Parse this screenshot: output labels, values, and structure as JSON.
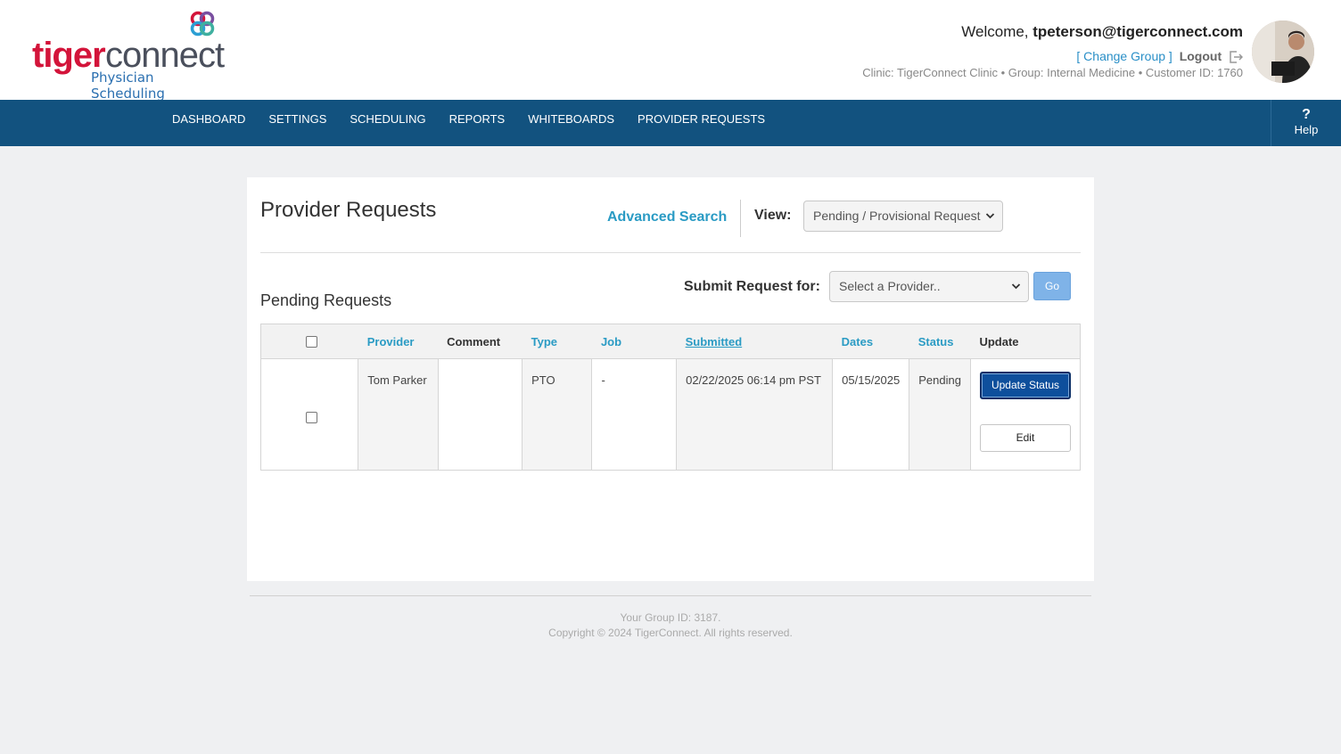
{
  "brand": {
    "logo_word_1": "tiger",
    "logo_word_2": "connect",
    "subtitle": "Physician Scheduling",
    "red": "#d3143a",
    "nav_blue": "#12527f"
  },
  "user": {
    "welcome_prefix": "Welcome, ",
    "email": "tpeterson@tigerconnect.com",
    "change_group": "[ Change Group ]",
    "logout": "Logout",
    "clinic_line": "Clinic: TigerConnect Clinic • Group: Internal Medicine • Customer ID: 1760"
  },
  "nav": {
    "items": [
      "DASHBOARD",
      "SETTINGS",
      "SCHEDULING",
      "REPORTS",
      "WHITEBOARDS",
      "PROVIDER REQUESTS"
    ],
    "help_icon": "?",
    "help_label": "Help"
  },
  "page": {
    "title": "Provider Requests",
    "advanced_search": "Advanced Search",
    "view_label": "View:",
    "view_value": "Pending / Provisional Request",
    "pending_title": "Pending Requests",
    "submit_label": "Submit Request for:",
    "provider_placeholder": "Select a Provider..",
    "go_label": "Go"
  },
  "table": {
    "headers": [
      "Provider",
      "Comment",
      "Type",
      "Job",
      "Submitted",
      "Dates",
      "Status",
      "Update"
    ],
    "rows": [
      {
        "provider": "Tom Parker",
        "comment": "",
        "type": "PTO",
        "job": "-",
        "submitted": "02/22/2025 06:14 pm PST",
        "dates": "05/15/2025",
        "status": "Pending",
        "update_status_label": "Update Status",
        "edit_label": "Edit"
      }
    ]
  },
  "footer": {
    "group_id": "Your Group ID: 3187.",
    "copyright": "Copyright © 2024 TigerConnect. All rights reserved."
  }
}
